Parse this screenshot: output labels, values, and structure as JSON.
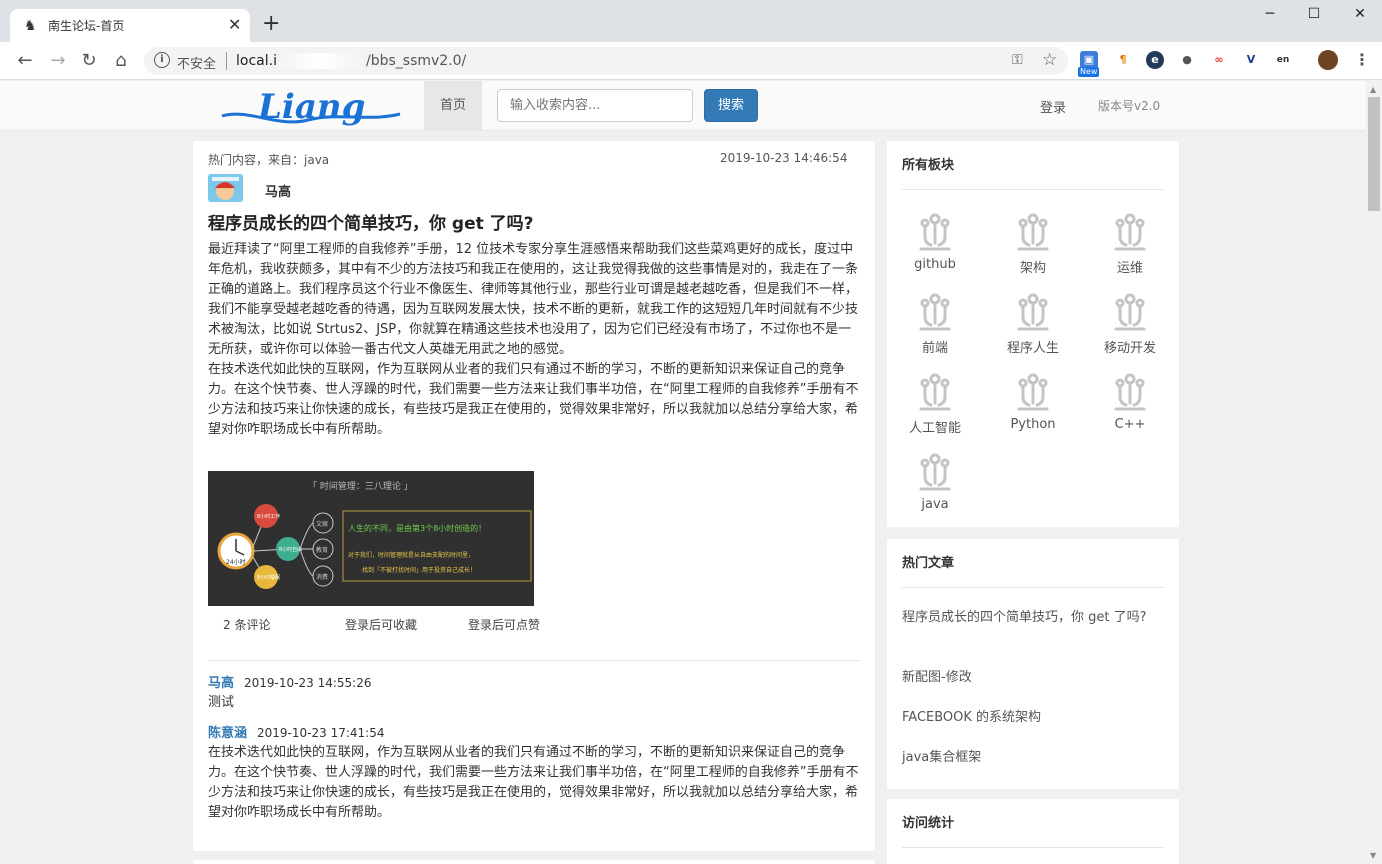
{
  "browser": {
    "tab_title": "南生论坛-首页",
    "tab_close": "✕",
    "new_tab": "+",
    "insecure_label": "不安全",
    "url_host": "local.i",
    "url_path": "/bbs_ssmv2.0/",
    "ext_new_badge": "New",
    "window_controls": [
      "─",
      "☐",
      "✕"
    ],
    "icons": {
      "back": "back-arrow-icon",
      "forward": "forward-arrow-icon",
      "reload": "reload-icon",
      "home": "home-icon",
      "info": "info-icon",
      "key": "key-icon",
      "star": "star-icon",
      "menu": "kebab-menu-icon"
    }
  },
  "header": {
    "logo_text": "Liang",
    "nav_home": "首页",
    "search_placeholder": "输入收索内容...",
    "search_button": "搜索",
    "login": "登录",
    "version": "版本号v2.0"
  },
  "post": {
    "meta": "热门内容，来自：java",
    "date": "2019-10-23 14:46:54",
    "author": "马高",
    "title": "程序员成长的四个简单技巧，你 get 了吗?",
    "paragraph1": "最近拜读了“阿里工程师的自我修养”手册，12 位技术专家分享生涯感悟来帮助我们这些菜鸡更好的成长，度过中年危机，我收获颇多，其中有不少的方法技巧和我正在使用的，这让我觉得我做的这些事情是对的，我走在了一条正确的道路上。我们程序员这个行业不像医生、律师等其他行业，那些行业可谓是越老越吃香，但是我们不一样，我们不能享受越老越吃香的待遇，因为互联网发展太快，技术不断的更新，就我工作的这短短几年时间就有不少技术被淘汰，比如说 Strtus2、JSP，你就算在精通这些技术也没用了，因为它们已经没有市场了，不过你也不是一无所获，或许你可以体验一番古代文人英雄无用武之地的感觉。",
    "paragraph2": "在技术迭代如此快的互联网，作为互联网从业者的我们只有通过不断的学习，不断的更新知识来保证自己的竞争力。在这个快节奏、世人浮躁的时代，我们需要一些方法来让我们事半功倍，在“阿里工程师的自我修养”手册有不少方法和技巧来让你快速的成长，有些技巧是我正在使用的，觉得效果非常好，所以我就加以总结分享给大家，希望对你咋职场成长中有所帮助。",
    "image": {
      "heading": "「 时间管理：三八理论 」",
      "slogan": "人生的不同，是由第3个8小时创造的！",
      "line1": "对于我们，时间管理就是从自由支配的时间里，",
      "line2": "找到「不被打扰时间」用于投资自己成长！",
      "clock_label": "24小时",
      "node_red": "8小时工作",
      "node_green": "8小时自由",
      "node_yellow": "8小时睡眠",
      "branches": [
        "文娱",
        "教育",
        "消费"
      ]
    },
    "comments_count": "2 条评论",
    "favorite": "登录后可收藏",
    "like": "登录后可点赞"
  },
  "comments": [
    {
      "user": "马高",
      "time": "2019-10-23 14:55:26",
      "text": "测试"
    },
    {
      "user": "陈意涵",
      "time": "2019-10-23 17:41:54",
      "text": "在技术迭代如此快的互联网，作为互联网从业者的我们只有通过不断的学习，不断的更新知识来保证自己的竞争力。在这个快节奏、世人浮躁的时代，我们需要一些方法来让我们事半功倍，在“阿里工程师的自我修养”手册有不少方法和技巧来让你快速的成长，有些技巧是我正在使用的，觉得效果非常好，所以我就加以总结分享给大家，希望对你咋职场成长中有所帮助。"
    }
  ],
  "sidebar": {
    "boards_title": "所有板块",
    "boards": [
      "github",
      "架构",
      "运维",
      "前端",
      "程序人生",
      "移动开发",
      "人工智能",
      "Python",
      "C++",
      "java"
    ],
    "hot_title": "热门文章",
    "hot": [
      "程序员成长的四个简单技巧，你 get 了吗?",
      "新配图-修改",
      "FACEBOOK 的系统架构",
      "java集合框架"
    ],
    "stats_title": "访问统计"
  },
  "colors": {
    "primary": "#337ab7",
    "logo": "#1a73d4"
  }
}
